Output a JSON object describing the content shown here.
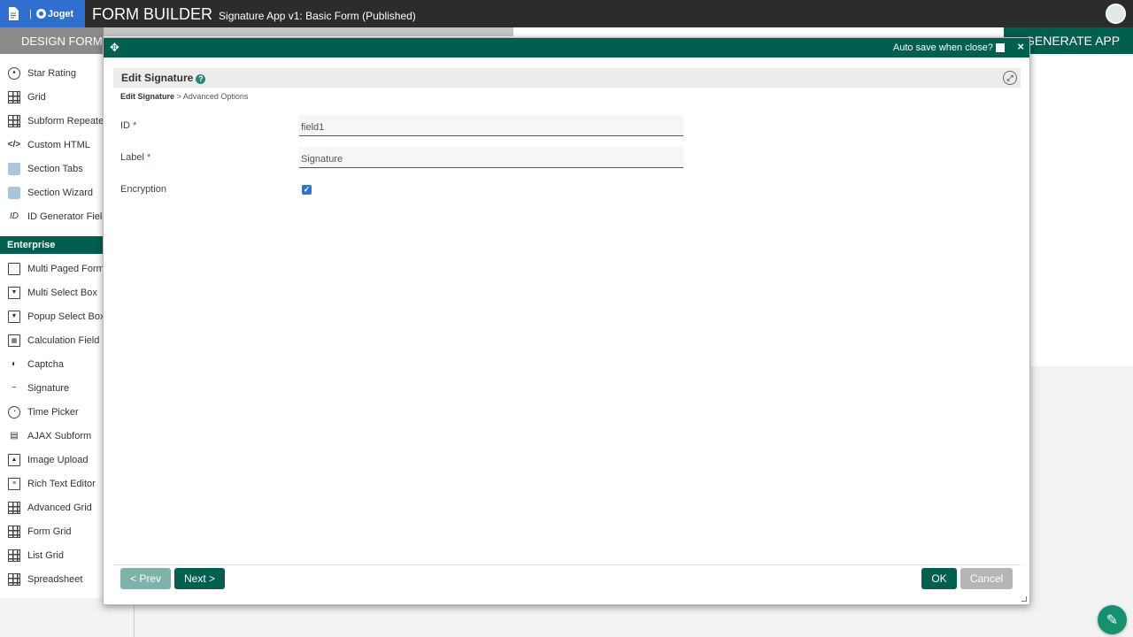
{
  "app": {
    "logo_text": "Joget",
    "title": "FORM BUILDER",
    "subtitle": "Signature App v1: Basic Form (Published)"
  },
  "tabs": {
    "design_form": "DESIGN FORM",
    "generate_app": "GENERATE APP"
  },
  "palette": {
    "items_top": [
      {
        "label": "Star Rating",
        "icon": "star-rating-icon"
      },
      {
        "label": "Grid",
        "icon": "grid-icon"
      },
      {
        "label": "Subform Repeater",
        "icon": "subform-repeater-icon"
      },
      {
        "label": "Custom HTML",
        "icon": "code-icon"
      },
      {
        "label": "Section Tabs",
        "icon": "section-tabs-icon"
      },
      {
        "label": "Section Wizard",
        "icon": "section-wizard-icon"
      },
      {
        "label": "ID Generator Field",
        "icon": "id-icon"
      }
    ],
    "section_label": "Enterprise",
    "items_enterprise": [
      {
        "label": "Multi Paged Form",
        "icon": "multi-paged-form-icon"
      },
      {
        "label": "Multi Select Box",
        "icon": "select-box-icon"
      },
      {
        "label": "Popup Select Box",
        "icon": "select-box-icon"
      },
      {
        "label": "Calculation Field",
        "icon": "calculator-icon"
      },
      {
        "label": "Captcha",
        "icon": "shield-icon"
      },
      {
        "label": "Signature",
        "icon": "signature-icon"
      },
      {
        "label": "Time Picker",
        "icon": "clock-icon"
      },
      {
        "label": "AJAX Subform",
        "icon": "document-icon"
      },
      {
        "label": "Image Upload",
        "icon": "image-icon"
      },
      {
        "label": "Rich Text Editor",
        "icon": "rich-text-icon"
      },
      {
        "label": "Advanced Grid",
        "icon": "grid-icon"
      },
      {
        "label": "Form Grid",
        "icon": "grid-icon"
      },
      {
        "label": "List Grid",
        "icon": "grid-icon"
      },
      {
        "label": "Spreadsheet",
        "icon": "grid-icon"
      }
    ]
  },
  "modal": {
    "autosave_label": "Auto save when close?",
    "close_symbol": "×",
    "panel_title": "Edit Signature",
    "breadcrumb_current": "Edit Signature",
    "breadcrumb_sep": ">",
    "breadcrumb_next": "Advanced Options",
    "fields": {
      "id_label": "ID",
      "id_value": "field1",
      "label_label": "Label",
      "label_value": "Signature",
      "encryption_label": "Encryption",
      "encryption_checked": true
    },
    "required_mark": "*",
    "buttons": {
      "prev": "< Prev",
      "next": "Next >",
      "ok": "OK",
      "cancel": "Cancel"
    }
  },
  "colors": {
    "brand_green": "#005f4e",
    "joget_blue": "#2f6fd0",
    "topbar": "#2c2c2c"
  }
}
